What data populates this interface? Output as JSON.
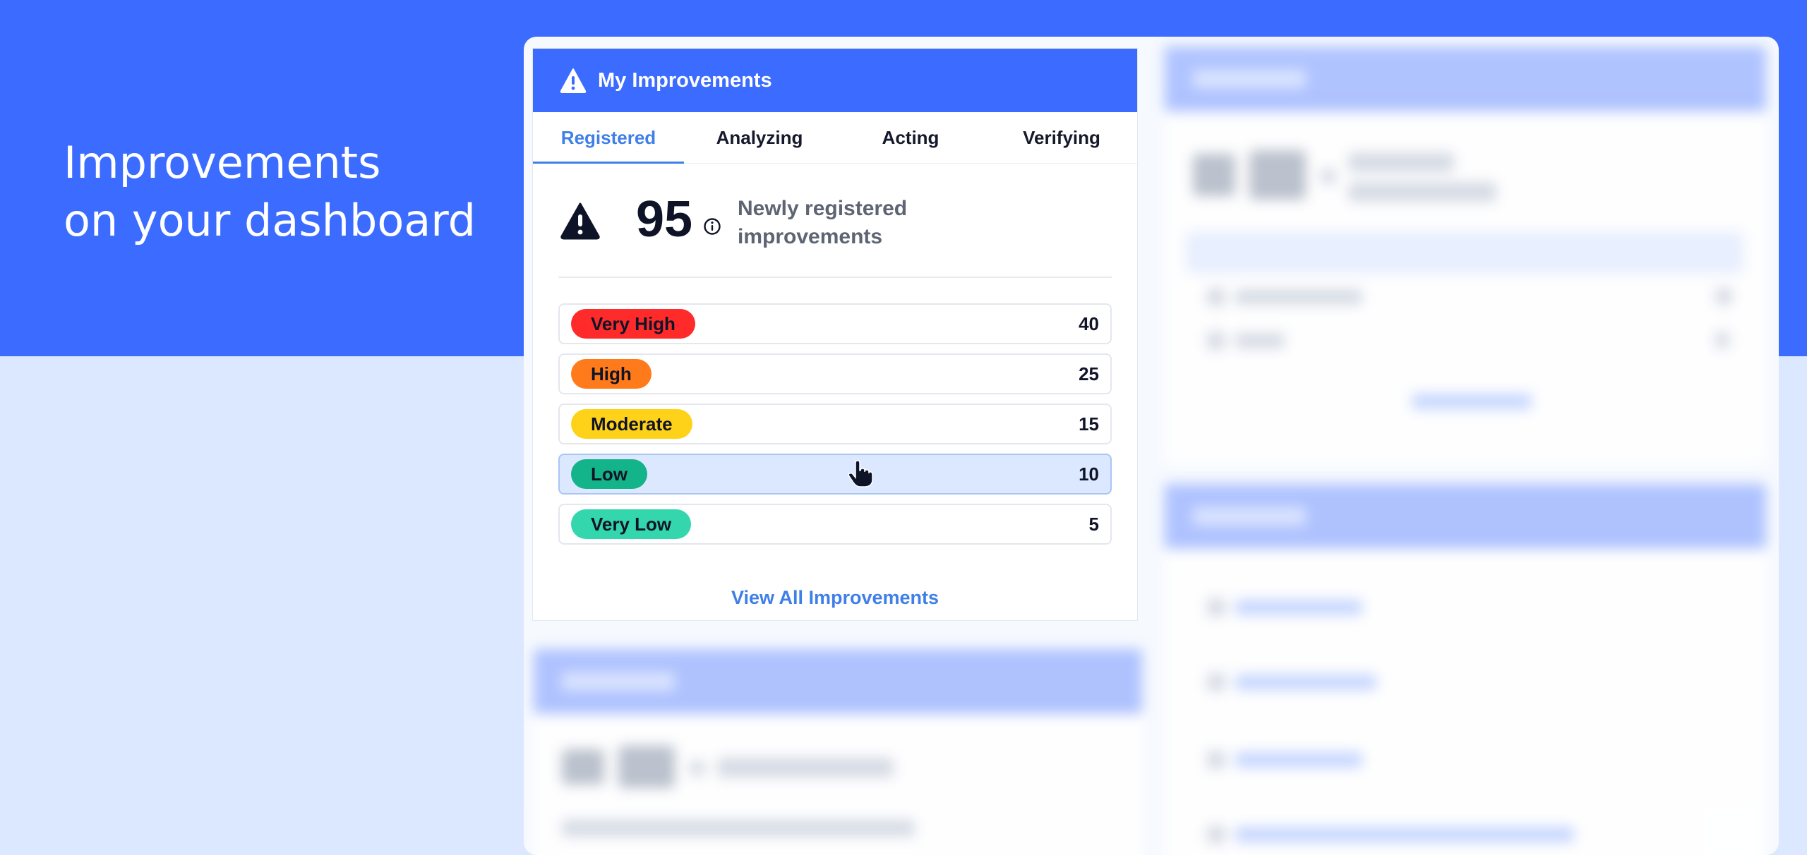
{
  "hero": {
    "line1": "Improvements",
    "line2": "on your dashboard"
  },
  "card": {
    "title": "My Improvements",
    "icon": "warning-triangle-icon",
    "tabs": [
      {
        "label": "Registered",
        "active": true
      },
      {
        "label": "Analyzing",
        "active": false
      },
      {
        "label": "Acting",
        "active": false
      },
      {
        "label": "Verifying",
        "active": false
      }
    ],
    "summary": {
      "count": "95",
      "description": "Newly registered improvements"
    },
    "rows": [
      {
        "label": "Very High",
        "value": "40",
        "color": "#ff2a2a"
      },
      {
        "label": "High",
        "value": "25",
        "color": "#ff7a1a"
      },
      {
        "label": "Moderate",
        "value": "15",
        "color": "#ffd21a"
      },
      {
        "label": "Low",
        "value": "10",
        "color": "#13b48a"
      },
      {
        "label": "Very Low",
        "value": "5",
        "color": "#33d6ad"
      }
    ],
    "view_all": "View All Improvements"
  },
  "colors": {
    "brand": "#3b6cff",
    "link": "#3f7fe8",
    "page_bg": "#dbe8ff"
  }
}
